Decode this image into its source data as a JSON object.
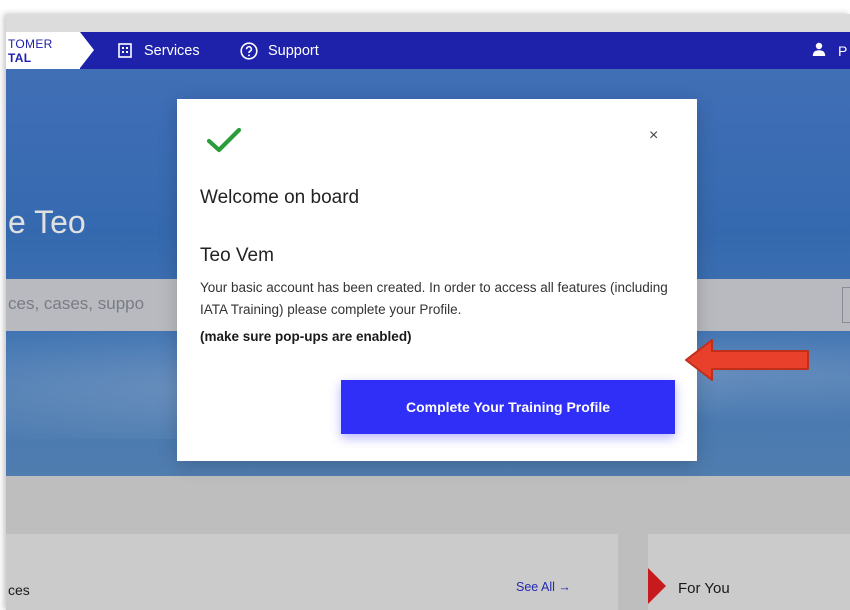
{
  "nav": {
    "brand_line1": "TOMER",
    "brand_line2": "TAL",
    "services_label": "Services",
    "support_label": "Support",
    "user_label": "P"
  },
  "hero": {
    "greeting": "e Teo",
    "search_placeholder": "ces, cases, suppo"
  },
  "cards": {
    "left_title": "ces",
    "see_all_label": "See All →",
    "right_title": "For You"
  },
  "modal": {
    "heading": "Welcome on board",
    "user_name": "Teo Vem",
    "message": "Your basic account has been created. In order to access all features (including IATA Training) please complete your Profile.",
    "note": "(make sure pop-ups are enabled)",
    "cta_label": "Complete Your Training Profile",
    "close_symbol": "×"
  },
  "colors": {
    "nav_bg": "#1e22aa",
    "cta_bg": "#2f2ff7",
    "check_green": "#2a9d3a",
    "arrow_red": "#e8402a",
    "accent_red": "#e31e23"
  },
  "icons": {
    "services": "building-icon",
    "support": "question-circle-icon",
    "user": "user-icon",
    "success": "checkmark-icon",
    "close": "close-icon",
    "annotation": "red-arrow-annotation"
  }
}
